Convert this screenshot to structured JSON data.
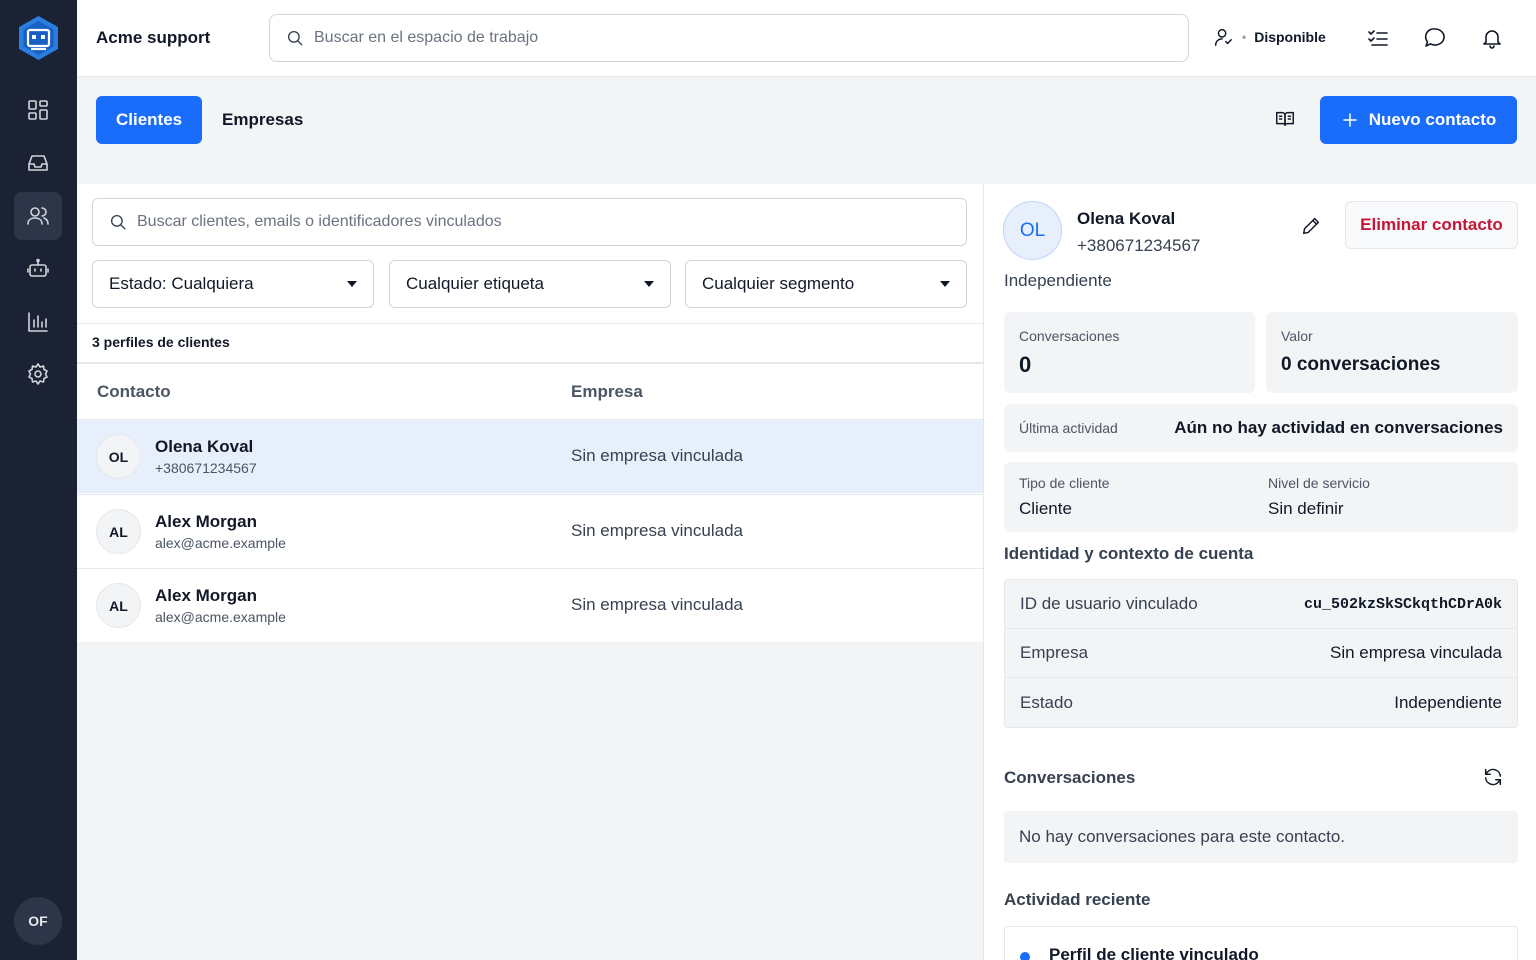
{
  "sidebar": {
    "items": [
      {
        "icon": "dashboard-icon"
      },
      {
        "icon": "inbox-icon"
      },
      {
        "icon": "users-icon",
        "active": true
      },
      {
        "icon": "bot-icon"
      },
      {
        "icon": "reports-icon"
      },
      {
        "icon": "settings-icon"
      }
    ],
    "user_initials": "OF"
  },
  "header": {
    "brand": "Acme support",
    "search_placeholder": "Buscar en el espacio de trabajo",
    "status_label": "Disponible"
  },
  "tabs": {
    "clientes": "Clientes",
    "empresas": "Empresas"
  },
  "toolbar": {
    "new_contact_label": "Nuevo contacto"
  },
  "list": {
    "search_placeholder": "Buscar clientes, emails o identificadores vinculados",
    "filters": {
      "estado": "Estado: Cualquiera",
      "etiqueta": "Cualquier etiqueta",
      "segmento": "Cualquier segmento"
    },
    "count_label": "3 perfiles de clientes",
    "columns": {
      "contacto": "Contacto",
      "empresa": "Empresa"
    },
    "rows": [
      {
        "initials": "OL",
        "name": "Olena Koval",
        "sub": "+380671234567",
        "company": "Sin empresa vinculada"
      },
      {
        "initials": "AL",
        "name": "Alex Morgan",
        "sub": "alex@acme.example",
        "company": "Sin empresa vinculada"
      },
      {
        "initials": "AL",
        "name": "Alex Morgan",
        "sub": "alex@acme.example",
        "company": "Sin empresa vinculada"
      }
    ]
  },
  "detail": {
    "initials": "OL",
    "name": "Olena Koval",
    "phone": "+380671234567",
    "delete_label": "Eliminar contacto",
    "state": "Independiente",
    "stats": {
      "conversations_label": "Conversaciones",
      "conversations_value": "0",
      "value_label": "Valor",
      "value_value": "0 conversaciones"
    },
    "last_activity": {
      "label": "Última actividad",
      "value": "Aún no hay actividad en conversaciones"
    },
    "type": {
      "label": "Tipo de cliente",
      "value": "Cliente"
    },
    "service": {
      "label": "Nivel de servicio",
      "value": "Sin definir"
    },
    "identity_title": "Identidad y contexto de cuenta",
    "identity": {
      "user_id_label": "ID de usuario vinculado",
      "user_id_value": "cu_502kzSkSCkqthCDrA0k",
      "company_label": "Empresa",
      "company_value": "Sin empresa vinculada",
      "state_label": "Estado",
      "state_value": "Independiente"
    },
    "conversations_title": "Conversaciones",
    "conversations_empty": "No hay conversaciones para este contacto.",
    "recent_title": "Actividad reciente",
    "recent_items": [
      "Perfil de cliente vinculado"
    ]
  },
  "colors": {
    "accent": "#1a6dfa",
    "sidebar_bg": "#1a2233",
    "danger": "#c5163a",
    "selected_row": "#e8effc"
  }
}
